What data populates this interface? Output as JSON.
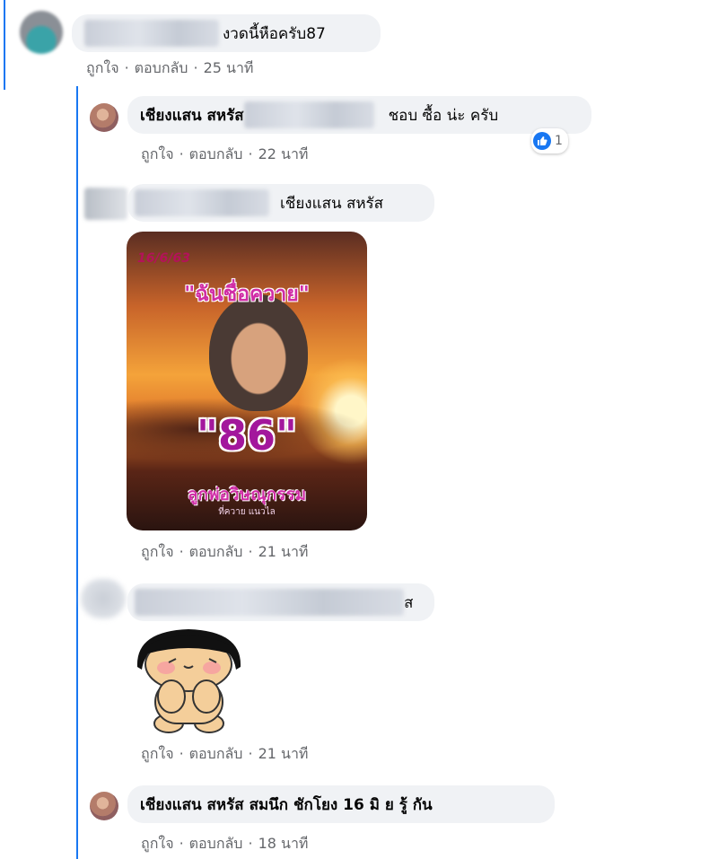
{
  "comments": [
    {
      "text": "งวดนี้หือครับ87",
      "actions": {
        "like": "ถูกใจ",
        "reply": "ตอบกลับ",
        "time": "25 นาที"
      }
    },
    {
      "name": "เชียงแสน สหรัส",
      "text": "ชอบ ซื้อ น่ะ ครับ",
      "reaction_count": "1",
      "actions": {
        "like": "ถูกใจ",
        "reply": "ตอบกลับ",
        "time": "22 นาที"
      }
    },
    {
      "mention": "เชียงแสน สหรัส",
      "image": {
        "date": "16/6/63",
        "title": "\"ฉันชื่อควาย\"",
        "number": "\"86\"",
        "caption": "ลูกพ่อวิษณุกรรม",
        "subcaption": "ที่ควาย แนวไล"
      },
      "actions": {
        "like": "ถูกใจ",
        "reply": "ตอบกลับ",
        "time": "21 นาที"
      }
    },
    {
      "name_tail": "ส",
      "actions": {
        "like": "ถูกใจ",
        "reply": "ตอบกลับ",
        "time": "21 นาที"
      }
    },
    {
      "name": "เชียงแสน สหรัส",
      "text": "สมนึก ชักโยง 16 มิ ย รู้ กัน",
      "actions": {
        "like": "ถูกใจ",
        "reply": "ตอบกลับ",
        "time": "18 นาที"
      }
    }
  ],
  "colors": {
    "accent": "#1877f2",
    "bubble": "#f0f2f5",
    "meta": "#65676b"
  }
}
